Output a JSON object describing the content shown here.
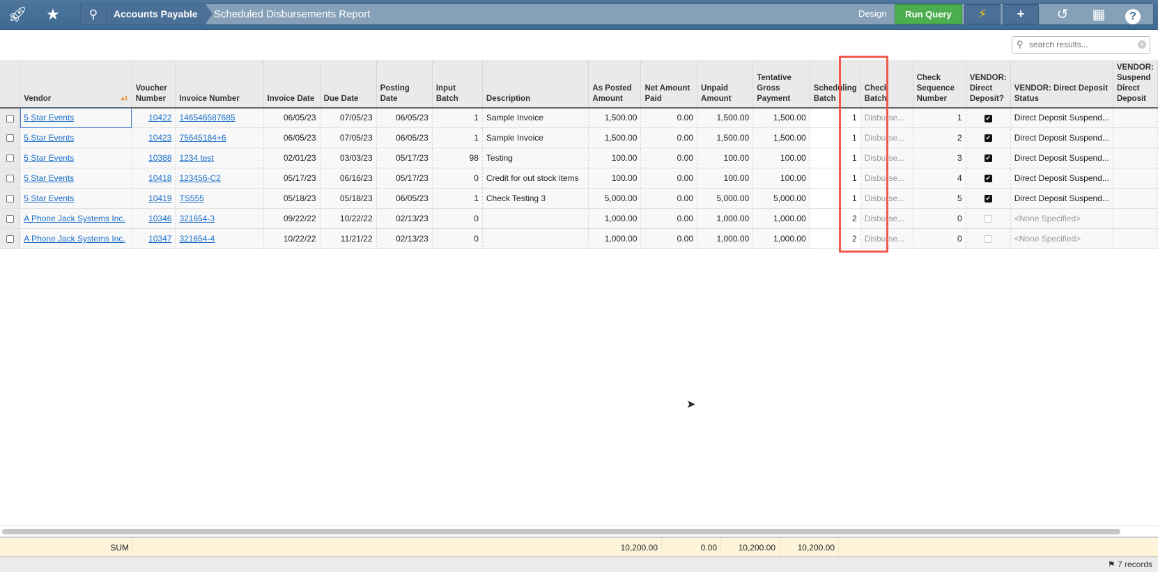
{
  "topbar": {
    "breadcrumb_module": "Accounts Payable",
    "breadcrumb_title": "Scheduled Disbursements Report",
    "design_label": "Design",
    "run_query_label": "Run Query",
    "icons": [
      "rocket-icon",
      "star-icon",
      "search-icon",
      "lightning-icon",
      "plus-icon",
      "history-icon",
      "grid-icon",
      "help-icon"
    ]
  },
  "search": {
    "placeholder": "search results...",
    "value": ""
  },
  "columns": [
    "Vendor",
    "Voucher Number",
    "Invoice Number",
    "Invoice Date",
    "Due Date",
    "Posting Date",
    "Input Batch",
    "Description",
    "As Posted Amount",
    "Net Amount Paid",
    "Unpaid Amount",
    "Tentative Gross Payment",
    "Scheduling Batch",
    "Check Batch",
    "Check Sequence Number",
    "VENDOR: Direct Deposit?",
    "VENDOR: Direct Deposit Status",
    "VENDOR: Suspend Direct Deposit"
  ],
  "sort_indicator": "1",
  "rows": [
    {
      "vendor": "5 Star Events",
      "voucher": "10422",
      "invoice": "146546587685",
      "invoice_date": "06/05/23",
      "due_date": "07/05/23",
      "posting_date": "06/05/23",
      "input_batch": "1",
      "description": "Sample Invoice",
      "as_posted": "1,500.00",
      "net_paid": "0.00",
      "unpaid": "1,500.00",
      "tentative": "1,500.00",
      "sched_batch": "1",
      "check_batch": "Disburse...",
      "check_seq": "1",
      "direct_deposit": true,
      "dd_status": "Direct Deposit Suspend..."
    },
    {
      "vendor": "5 Star Events",
      "voucher": "10423",
      "invoice": "75645184+6",
      "invoice_date": "06/05/23",
      "due_date": "07/05/23",
      "posting_date": "06/05/23",
      "input_batch": "1",
      "description": "Sample Invoice",
      "as_posted": "1,500.00",
      "net_paid": "0.00",
      "unpaid": "1,500.00",
      "tentative": "1,500.00",
      "sched_batch": "1",
      "check_batch": "Disburse...",
      "check_seq": "2",
      "direct_deposit": true,
      "dd_status": "Direct Deposit Suspend..."
    },
    {
      "vendor": "5 Star Events",
      "voucher": "10388",
      "invoice": "1234 test",
      "invoice_date": "02/01/23",
      "due_date": "03/03/23",
      "posting_date": "05/17/23",
      "input_batch": "98",
      "description": "Testing",
      "as_posted": "100.00",
      "net_paid": "0.00",
      "unpaid": "100.00",
      "tentative": "100.00",
      "sched_batch": "1",
      "check_batch": "Disburse...",
      "check_seq": "3",
      "direct_deposit": true,
      "dd_status": "Direct Deposit Suspend..."
    },
    {
      "vendor": "5 Star Events",
      "voucher": "10418",
      "invoice": "123456-C2",
      "invoice_date": "05/17/23",
      "due_date": "06/16/23",
      "posting_date": "05/17/23",
      "input_batch": "0",
      "description": "Credit for out stock items",
      "as_posted": "100.00",
      "net_paid": "0.00",
      "unpaid": "100.00",
      "tentative": "100.00",
      "sched_batch": "1",
      "check_batch": "Disburse...",
      "check_seq": "4",
      "direct_deposit": true,
      "dd_status": "Direct Deposit Suspend..."
    },
    {
      "vendor": "5 Star Events",
      "voucher": "10419",
      "invoice": "TS555",
      "invoice_date": "05/18/23",
      "due_date": "05/18/23",
      "posting_date": "06/05/23",
      "input_batch": "1",
      "description": "Check Testing 3",
      "as_posted": "5,000.00",
      "net_paid": "0.00",
      "unpaid": "5,000.00",
      "tentative": "5,000.00",
      "sched_batch": "1",
      "check_batch": "Disburse...",
      "check_seq": "5",
      "direct_deposit": true,
      "dd_status": "Direct Deposit Suspend..."
    },
    {
      "vendor": "A Phone Jack Systems Inc.",
      "voucher": "10346",
      "invoice": "321654-3",
      "invoice_date": "09/22/22",
      "due_date": "10/22/22",
      "posting_date": "02/13/23",
      "input_batch": "0",
      "description": "",
      "as_posted": "1,000.00",
      "net_paid": "0.00",
      "unpaid": "1,000.00",
      "tentative": "1,000.00",
      "sched_batch": "2",
      "check_batch": "Disburse...",
      "check_seq": "0",
      "direct_deposit": false,
      "dd_status": "<None Specified>"
    },
    {
      "vendor": "A Phone Jack Systems Inc.",
      "voucher": "10347",
      "invoice": "321654-4",
      "invoice_date": "10/22/22",
      "due_date": "11/21/22",
      "posting_date": "02/13/23",
      "input_batch": "0",
      "description": "",
      "as_posted": "1,000.00",
      "net_paid": "0.00",
      "unpaid": "1,000.00",
      "tentative": "1,000.00",
      "sched_batch": "2",
      "check_batch": "Disburse...",
      "check_seq": "0",
      "direct_deposit": false,
      "dd_status": "<None Specified>"
    }
  ],
  "sum": {
    "label": "SUM",
    "as_posted": "10,200.00",
    "net_paid": "0.00",
    "unpaid": "10,200.00",
    "tentative": "10,200.00"
  },
  "status": {
    "records": "7 records"
  },
  "colors": {
    "topbar": "#3e6a93",
    "run_query": "#4cae4f",
    "link": "#1a6fc9",
    "highlight": "#ef5a4c",
    "sum_row": "#fdf4da"
  }
}
